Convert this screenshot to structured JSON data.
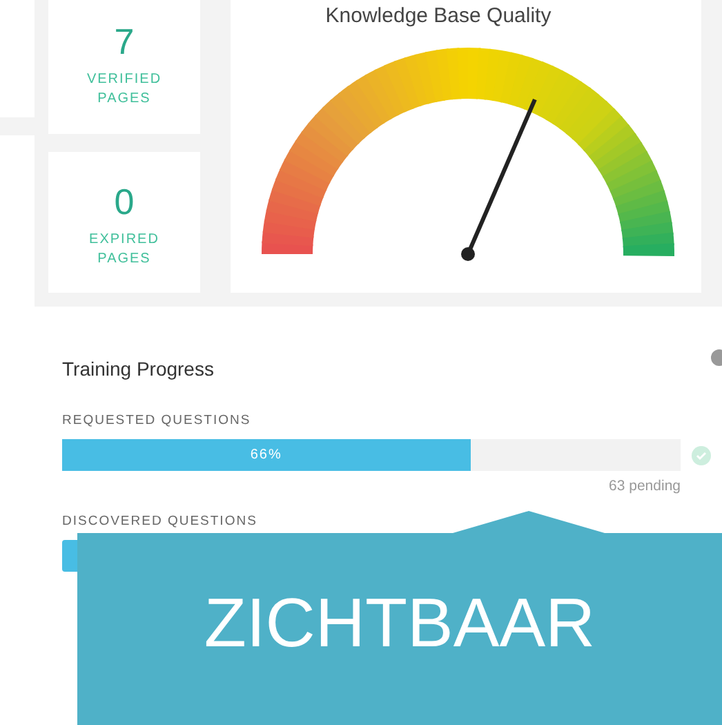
{
  "stats": [
    {
      "value": "7",
      "label": "VERIFIED PAGES"
    },
    {
      "value": "0",
      "label": "EXPIRED PAGES"
    }
  ],
  "gauge": {
    "title": "Knowledge Base Quality",
    "level": 0.63
  },
  "training": {
    "title": "Training Progress",
    "sections": [
      {
        "label": "REQUESTED QUESTIONS",
        "level": 0.66,
        "reading": "66%",
        "complete": true,
        "note": "63 pending"
      },
      {
        "label": "DISCOVERED QUESTIONS"
      }
    ]
  },
  "banner": {
    "text": "ZICHTBAAR"
  }
}
